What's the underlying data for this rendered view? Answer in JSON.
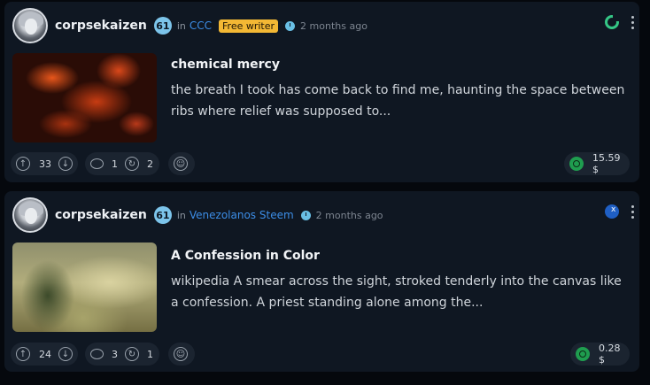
{
  "posts": [
    {
      "author": "corpsekaizen",
      "reputation": "61",
      "in_label": "in",
      "community": "CCC",
      "badge": "Free writer",
      "time": "2 months ago",
      "app_icon": "green-ring-app-icon",
      "title": "chemical mercy",
      "excerpt": "the breath I took has come back to find me, haunting the space between ribs where relief was supposed to...",
      "upvotes": "33",
      "comments": "1",
      "reblogs": "2",
      "payout": "15.59 $"
    },
    {
      "author": "corpsekaizen",
      "reputation": "61",
      "in_label": "in",
      "community": "Venezolanos Steem",
      "time": "2 months ago",
      "app_icon": "blue-x-app-icon",
      "title": "A Confession in Color",
      "excerpt": "wikipedia A smear across the sight, stroked tenderly into the canvas like a confession. A priest standing alone among the...",
      "upvotes": "24",
      "comments": "3",
      "reblogs": "1",
      "payout": "0.28 $"
    }
  ],
  "colors": {
    "card_bg": "#0f1722",
    "page_bg": "#05080d",
    "badge": "#f3b834",
    "link": "#3c8de6",
    "reputation": "#7cc4ea",
    "steem_green": "#1f9d4f"
  }
}
